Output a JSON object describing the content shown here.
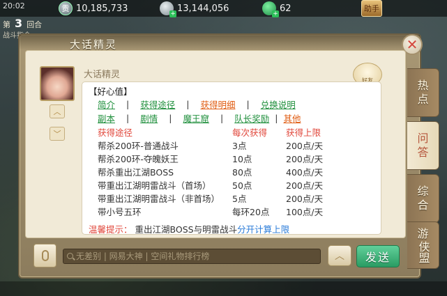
{
  "status_bar": {
    "time": "20:02",
    "currency_gong": "10,185,733",
    "currency_silver": "13,144,056",
    "currency_jade": "62",
    "gong_icon_char": "贡",
    "right_badge": "助手"
  },
  "battle": {
    "round_prefix": "第",
    "round_num": "3",
    "round_suffix": "回合",
    "command": "战斗指令"
  },
  "dialog": {
    "title": "大话精灵",
    "close_glyph": "✕",
    "speaker": "大话精灵",
    "mascot_label": "好友",
    "header": "【好心值】",
    "nav_row1": [
      {
        "label": "简介",
        "color": "green"
      },
      {
        "label": "获得途径",
        "color": "green"
      },
      {
        "label": "获得明细",
        "color": "orange"
      },
      {
        "label": "兑换说明",
        "color": "green"
      }
    ],
    "nav_row2": [
      {
        "label": "副本",
        "color": "green"
      },
      {
        "label": "剧情",
        "color": "green"
      },
      {
        "label": "魔王窟",
        "color": "green"
      },
      {
        "label": "队长奖励",
        "color": "green"
      },
      {
        "label": "其他",
        "color": "orange"
      }
    ],
    "table": {
      "headers": [
        "获得途径",
        "每次获得",
        "获得上限"
      ],
      "rows": [
        [
          "帮杀200环-普通战斗",
          "3点",
          "200点/天"
        ],
        [
          "帮杀200环-夺魄妖王",
          "10点",
          "200点/天"
        ],
        [
          "帮杀重出江湖BOSS",
          "80点",
          "400点/天"
        ],
        [
          "带重出江湖明雷战斗（首场）",
          "50点",
          "200点/天"
        ],
        [
          "带重出江湖明雷战斗（非首场）",
          "5点",
          "200点/天"
        ],
        [
          "带小号五环",
          "每环20点",
          "100点/天"
        ]
      ]
    },
    "tip": {
      "label": "温馨提示：",
      "text": "重出江湖BOSS与明雷战斗",
      "link": "分开计算上限"
    }
  },
  "side_tabs": [
    {
      "label_top": "热",
      "label_bottom": "点",
      "active": false
    },
    {
      "label_top": "问",
      "label_bottom": "答",
      "active": true
    },
    {
      "label_top": "综",
      "label_bottom": "合",
      "active": false
    },
    {
      "label_top": "游",
      "label_bottom": "侠盟",
      "active": false
    }
  ],
  "input_bar": {
    "placeholder": "无差别 | 网易大神 | 空间礼物排行榜",
    "up_glyph": "︿",
    "send_label": "发送"
  },
  "colors": {
    "green_link": "#1f8f3c",
    "orange_link": "#e05c12",
    "red_text": "#e0463a",
    "blue_link": "#2a7bd8",
    "send_green": "#2a9c63"
  }
}
